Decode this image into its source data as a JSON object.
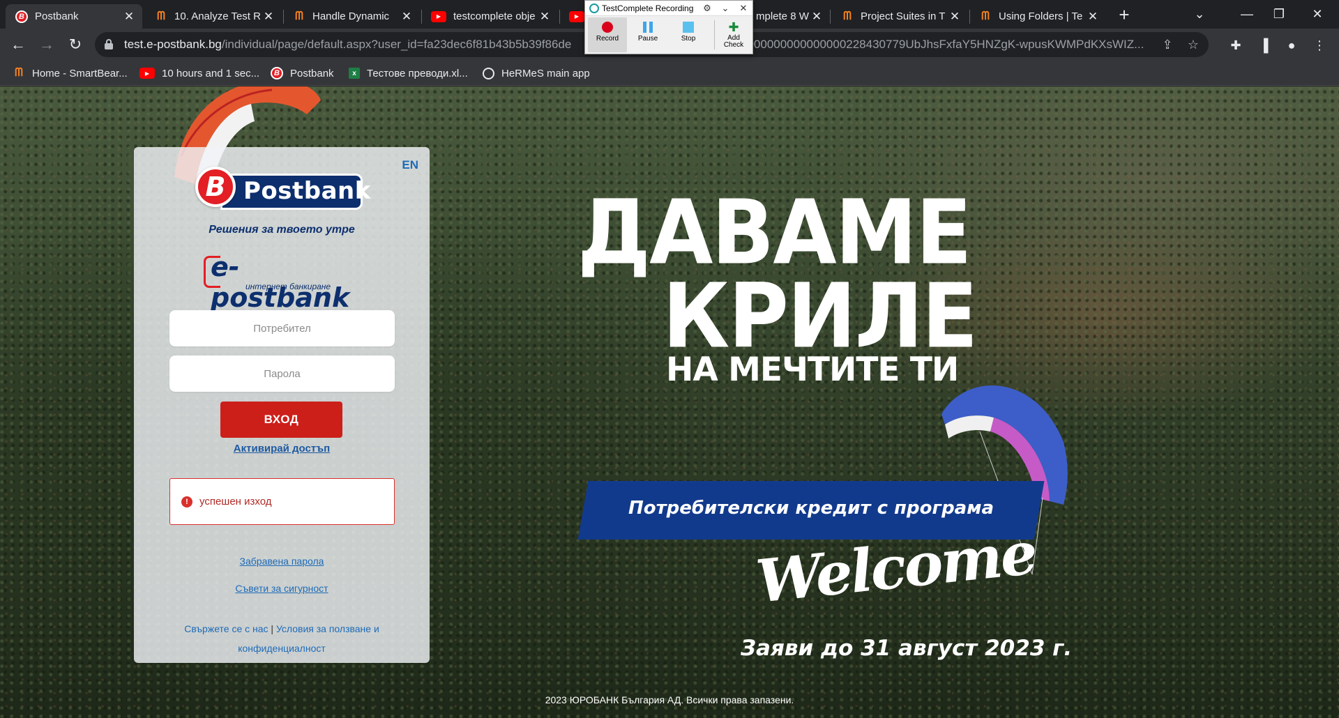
{
  "browser": {
    "tabs": [
      {
        "title": "Postbank",
        "icon": "postbank-icon",
        "active": true
      },
      {
        "title": "10. Analyze Test R",
        "icon": "smartbear-icon",
        "active": false
      },
      {
        "title": "Handle Dynamic",
        "icon": "smartbear-icon",
        "active": false
      },
      {
        "title": "testcomplete obje",
        "icon": "youtube-icon",
        "active": false
      },
      {
        "title": "",
        "icon": "youtube-icon",
        "active": false
      },
      {
        "title": "mplete 8 W",
        "icon": "smartbear-icon",
        "active": false
      },
      {
        "title": "Project Suites in T",
        "icon": "smartbear-icon",
        "active": false
      },
      {
        "title": "Using Folders | Te",
        "icon": "smartbear-icon",
        "active": false
      }
    ],
    "url_host": "test.e-postbank.bg",
    "url_path": "/individual/page/default.aspx?user_id=fa23dec6f81b43b5b39f86de",
    "url_tail": "0000000000000000228430779UbJhsFxfaY5HNZgK-wpusKWMPdKXsWIZ...",
    "bookmarks": [
      {
        "label": "Home - SmartBear...",
        "icon": "smartbear-icon"
      },
      {
        "label": "10 hours and 1 sec...",
        "icon": "youtube-icon"
      },
      {
        "label": "Postbank",
        "icon": "postbank-icon"
      },
      {
        "label": "Тестове преводи.xl...",
        "icon": "excel-icon"
      },
      {
        "label": "HeRMeS main app",
        "icon": "globe-icon"
      }
    ]
  },
  "testcomplete": {
    "title": "TestComplete Recording",
    "buttons": {
      "record": "Record",
      "pause": "Pause",
      "stop": "Stop",
      "add_check_1": "Add",
      "add_check_2": "Check"
    }
  },
  "login": {
    "lang": "EN",
    "brand": "Postbank",
    "tagline": "Решения за твоето утре",
    "ep_brand": "e-postbank",
    "ep_sub": "интернет банкиране",
    "username_placeholder": "Потребител",
    "password_placeholder": "Парола",
    "login_button": "ВХОД",
    "activate_link": "Активирай достъп",
    "alert_text": "успешен изход",
    "forgot_link": "Забравена парола",
    "security_link": "Съвети за сигурност",
    "contact_link": "Свържете се с нас",
    "terms_link": "Условия за ползване и конфиденциалност"
  },
  "hero": {
    "line1": "ДАВАМЕ",
    "line2": "КРИЛЕ",
    "line3": "НА МЕЧТИТЕ ТИ",
    "banner": "Потребителски кредит с програма",
    "welcome": "Welcome",
    "deadline": "Заяви до 31 август 2023 г."
  },
  "footer": {
    "copyright": "2023 ЮРОБАНК България АД. Всички права запазени."
  },
  "colors": {
    "brand_navy": "#0d2f6e",
    "brand_red": "#e31e24",
    "button_red": "#cc1f1a",
    "link_blue": "#1e6bb8",
    "banner_blue": "#123a8c"
  }
}
